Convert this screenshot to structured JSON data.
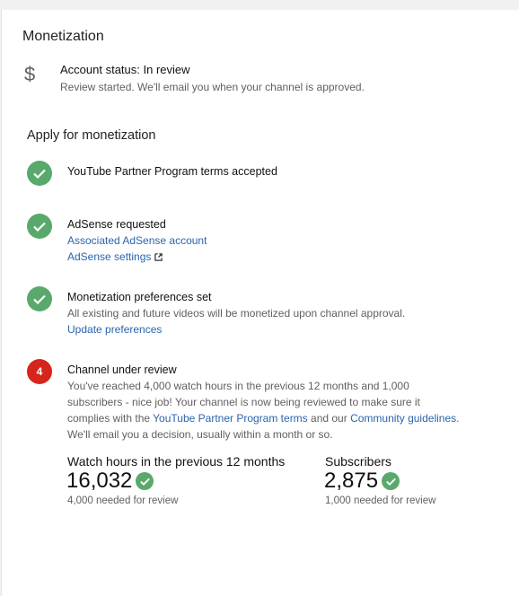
{
  "card": {
    "title": "Monetization"
  },
  "account_status": {
    "icon": "dollar-icon",
    "symbol": "$",
    "title": "Account status: In review",
    "subtitle": "Review started. We'll email you when your channel is approved."
  },
  "apply": {
    "title": "Apply for monetization",
    "steps": [
      {
        "title": "YouTube Partner Program terms accepted",
        "state": "done"
      },
      {
        "title": "AdSense requested",
        "state": "done",
        "links": [
          "Associated AdSense account",
          "AdSense settings"
        ]
      },
      {
        "title": "Monetization preferences set",
        "state": "done",
        "subtitle": "All existing and future videos will be monetized upon channel approval.",
        "link": "Update preferences"
      },
      {
        "title": "Channel under review",
        "state": "current",
        "number": "4",
        "line1": "You've reached 4,000 watch hours in the previous 12 months and 1,000",
        "line2": "subscribers - nice job! Your channel is now being reviewed to make sure it",
        "line3_prefix": "complies with the ",
        "line3_link1": "YouTube Partner Program terms",
        "line3_mid": " and our ",
        "line3_link2": "Community guidelines",
        "line3_suffix": ".",
        "line4": "We'll email you a decision, usually within a month or so."
      }
    ]
  },
  "stats": {
    "watch_hours": {
      "label": "Watch hours in the previous 12 months",
      "value": "16,032",
      "note": "4,000 needed for review"
    },
    "subscribers": {
      "label": "Subscribers",
      "value": "2,875",
      "note": "1,000 needed for review"
    }
  },
  "colors": {
    "check_green": "#5aa96c",
    "current_red": "#d6261b",
    "link_blue": "#2b64ac"
  }
}
